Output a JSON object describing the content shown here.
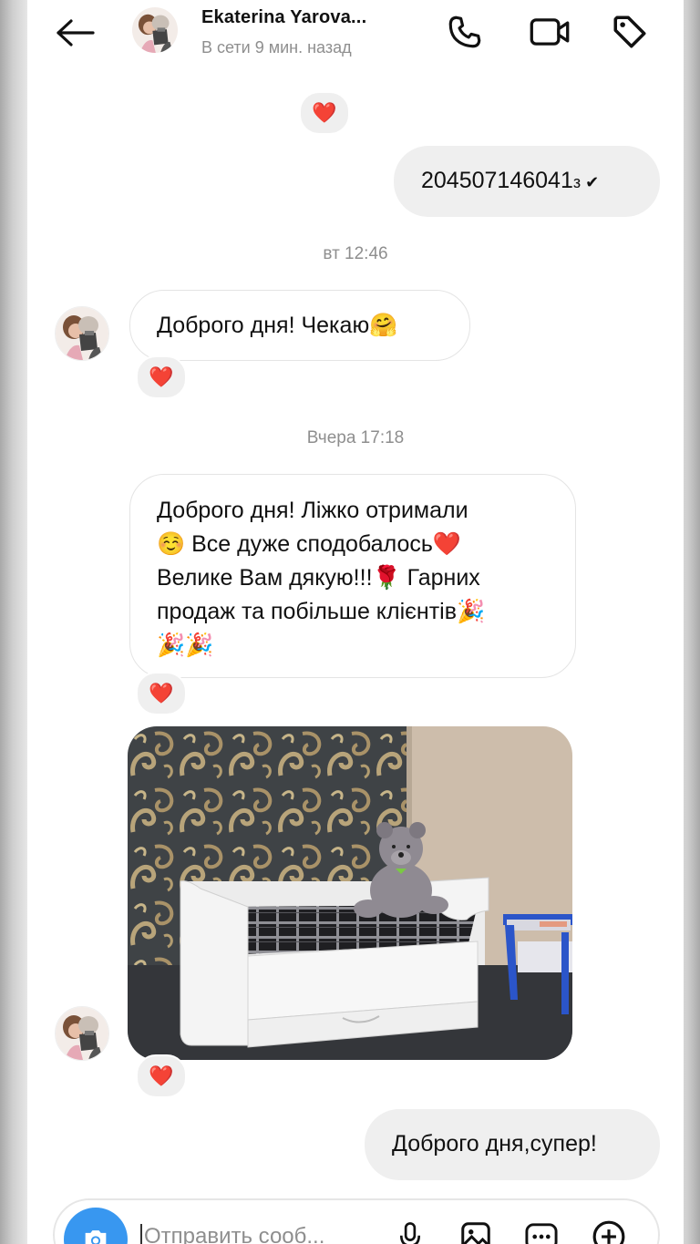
{
  "header": {
    "contact_name": "Ekaterina Yarova...",
    "status": "В сети 9 мин. назад"
  },
  "messages": {
    "number_message": "204507146041",
    "number_suffix": "з ✔",
    "timestamp_1": "вт 12:46",
    "incoming_1": "Доброго дня! Чекаю",
    "incoming_1_emoji": "🤗",
    "timestamp_2": "Вчера 17:18",
    "incoming_2_lines": [
      "Доброго дня! Ліжко отримали",
      "☺️ Все дуже сподобалось❤️",
      "Велике Вам дякую!!!🌹 Гарних",
      "продаж та побільше клієнтів🎉",
      "🎉🎉"
    ],
    "outgoing_last": "Доброго дня,супер!",
    "reaction_emoji": "❤️"
  },
  "composer": {
    "placeholder": "Отправить сооб..."
  },
  "colors": {
    "accent": "#3897f0",
    "outgoing_bubble": "#efefef",
    "muted_text": "#8e8e8e",
    "heart": "#ed2a3a"
  },
  "icons": {
    "back": "arrow-left-icon",
    "call": "phone-icon",
    "video": "video-camera-icon",
    "tag": "tag-icon",
    "camera": "camera-icon",
    "mic": "microphone-icon",
    "gallery": "image-icon",
    "sticker": "sticker-icon",
    "plus": "plus-circle-icon"
  }
}
